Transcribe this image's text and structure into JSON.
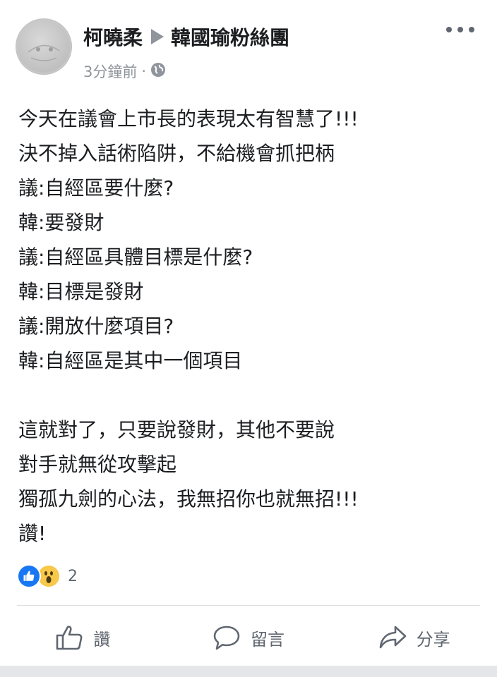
{
  "header": {
    "author": "柯曉柔",
    "group": "韓國瑜粉絲團",
    "time": "3分鐘前",
    "separator": "·",
    "privacy_icon": "globe-icon",
    "menu_icon": "more-dots-icon"
  },
  "post": {
    "lines": [
      "今天在議會上市長的表現太有智慧了!!!",
      "決不掉入話術陷阱，不給機會抓把柄",
      "議:自經區要什麼?",
      "韓:要發財",
      "議:自經區具體目標是什麼?",
      "韓:目標是發財",
      "議:開放什麼項目?",
      "韓:自經區是其中一個項目",
      "",
      "這就對了，只要說發財，其他不要說",
      "對手就無從攻擊起",
      "獨孤九劍的心法，我無招你也就無招!!!",
      "讚!"
    ]
  },
  "reactions": {
    "icons": [
      "like-reaction-icon",
      "wow-reaction-icon"
    ],
    "count": "2"
  },
  "actions": [
    {
      "label": "讚",
      "icon": "thumbs-up-icon"
    },
    {
      "label": "留言",
      "icon": "comment-icon"
    },
    {
      "label": "分享",
      "icon": "share-icon"
    }
  ],
  "colors": {
    "text": "#1c1e21",
    "muted": "#90949c",
    "like_blue": "#1877f2",
    "wow_yellow": "#f7c84a"
  }
}
